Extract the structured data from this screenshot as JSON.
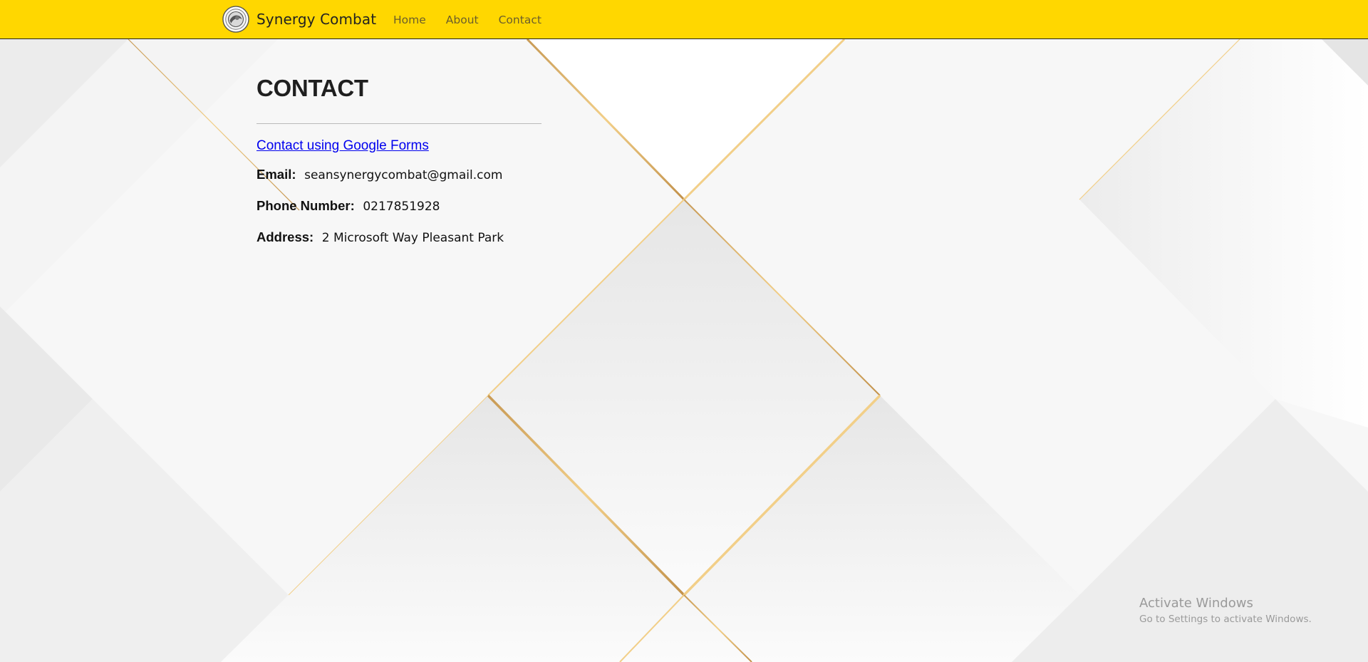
{
  "navbar": {
    "brand_name": "Synergy Combat",
    "links": [
      {
        "label": "Home"
      },
      {
        "label": "About"
      },
      {
        "label": "Contact"
      }
    ]
  },
  "main": {
    "title": "CONTACT",
    "contact_link": "Contact using Google Forms",
    "email_label": "Email:",
    "email_value": "seansynergycombat@gmail.com",
    "phone_label": "Phone Number:",
    "phone_value": "0217851928",
    "address_label": "Address:",
    "address_value": "2 Microsoft Way Pleasant Park"
  },
  "watermark": {
    "title": "Activate Windows",
    "subtitle": "Go to Settings to activate Windows."
  },
  "colors": {
    "navbar_bg": "#ffd700",
    "link": "#0000ee",
    "gold_line": "#d4a24a"
  },
  "icons": {
    "brand_logo": "logo-icon"
  }
}
